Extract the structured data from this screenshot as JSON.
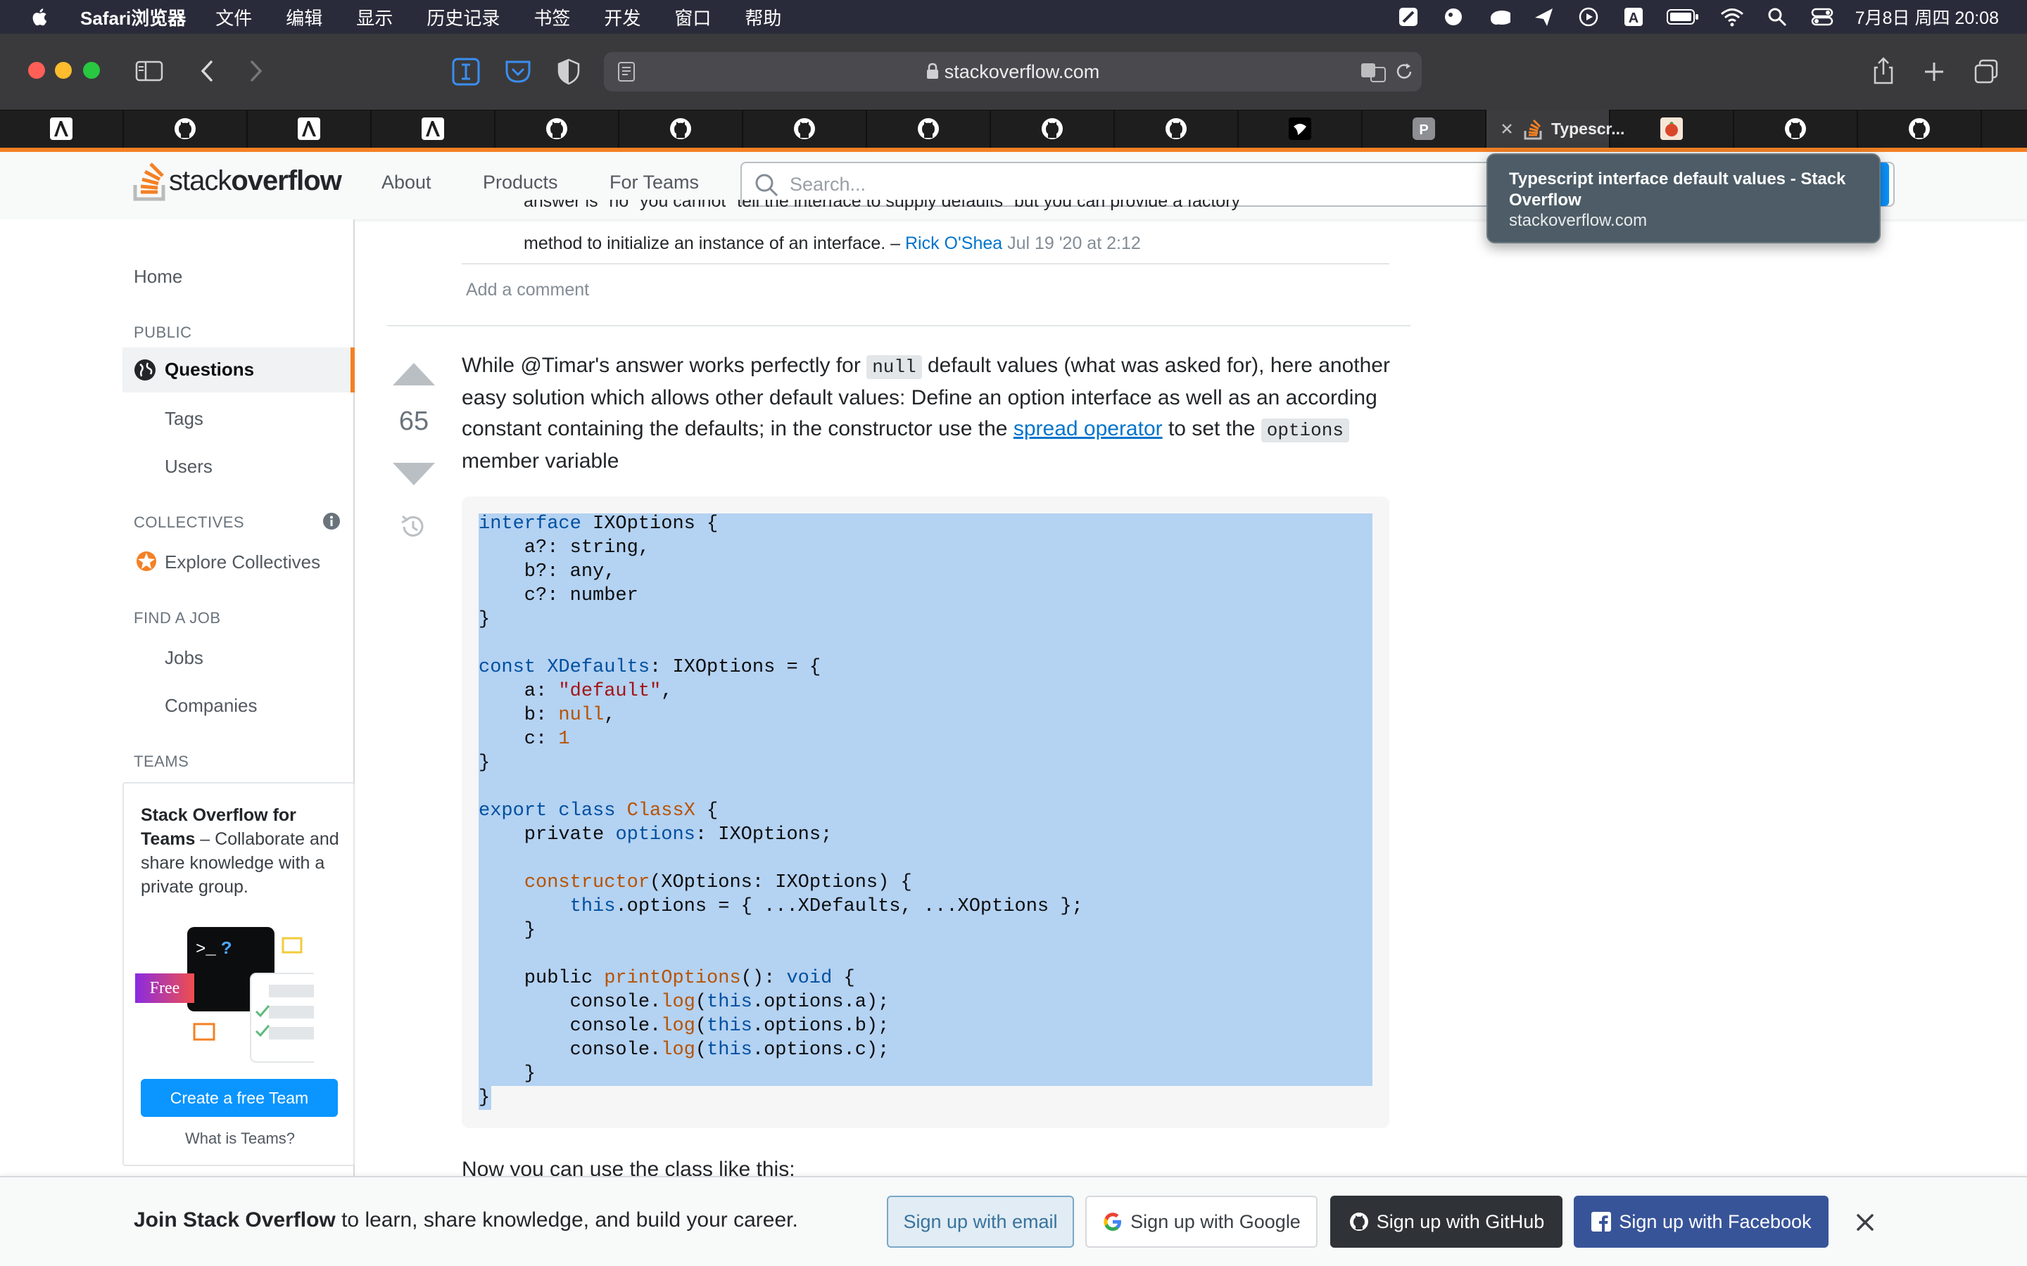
{
  "menubar": {
    "app_name": "Safari浏览器",
    "menus": [
      "文件",
      "编辑",
      "显示",
      "历史记录",
      "书签",
      "开发",
      "窗口",
      "帮助"
    ],
    "clock": "7月8日 周四  20:08"
  },
  "safari": {
    "url": "stackoverflow.com",
    "active_tab_title": "Typescr..."
  },
  "tooltip": {
    "title": "Typescript interface default values - Stack Overflow",
    "url": "stackoverflow.com"
  },
  "so_header": {
    "logo_light": "stack",
    "logo_bold": "overflow",
    "nav": [
      "About",
      "Products",
      "For Teams"
    ],
    "search_placeholder": "Search..."
  },
  "leftnav": {
    "home": "Home",
    "public_heading": "PUBLIC",
    "questions": "Questions",
    "tags": "Tags",
    "users": "Users",
    "collectives_heading": "COLLECTIVES",
    "explore_collectives": "Explore Collectives",
    "find_job_heading": "FIND A JOB",
    "jobs": "Jobs",
    "companies": "Companies",
    "teams_heading": "TEAMS",
    "teams_title": "Stack Overflow for Teams",
    "teams_desc": " – Collaborate and share knowledge with a private group.",
    "free_badge": "Free",
    "create_team": "Create a free Team",
    "what_is_teams": "What is Teams?"
  },
  "comment": {
    "text_line1": "answer is \"no\" you cannot \"tell the interface to supply defaults\" but you can provide a factory",
    "text_line2": "method to initialize an instance of an interface. – ",
    "author": "Rick O'Shea",
    "date": "Jul 19 '20 at 2:12",
    "add_comment": "Add a comment"
  },
  "answer": {
    "votes": "65",
    "p1": "While @Timar's answer works perfectly for ",
    "code_null": "null",
    "p2": " default values (what was asked for), here another easy solution which allows other default values: Define an option interface as well as an according constant containing the defaults; in the constructor use the ",
    "link": "spread operator",
    "p3": " to set the ",
    "code_options": "options",
    "p4": " member variable",
    "after_code": "Now you can use the class like this:"
  },
  "banner": {
    "bold": "Join Stack Overflow",
    "rest": " to learn, share knowledge, and build your career.",
    "email": "Sign up with email",
    "google": "Sign up with Google",
    "github": "Sign up with GitHub",
    "facebook": "Sign up with Facebook"
  }
}
